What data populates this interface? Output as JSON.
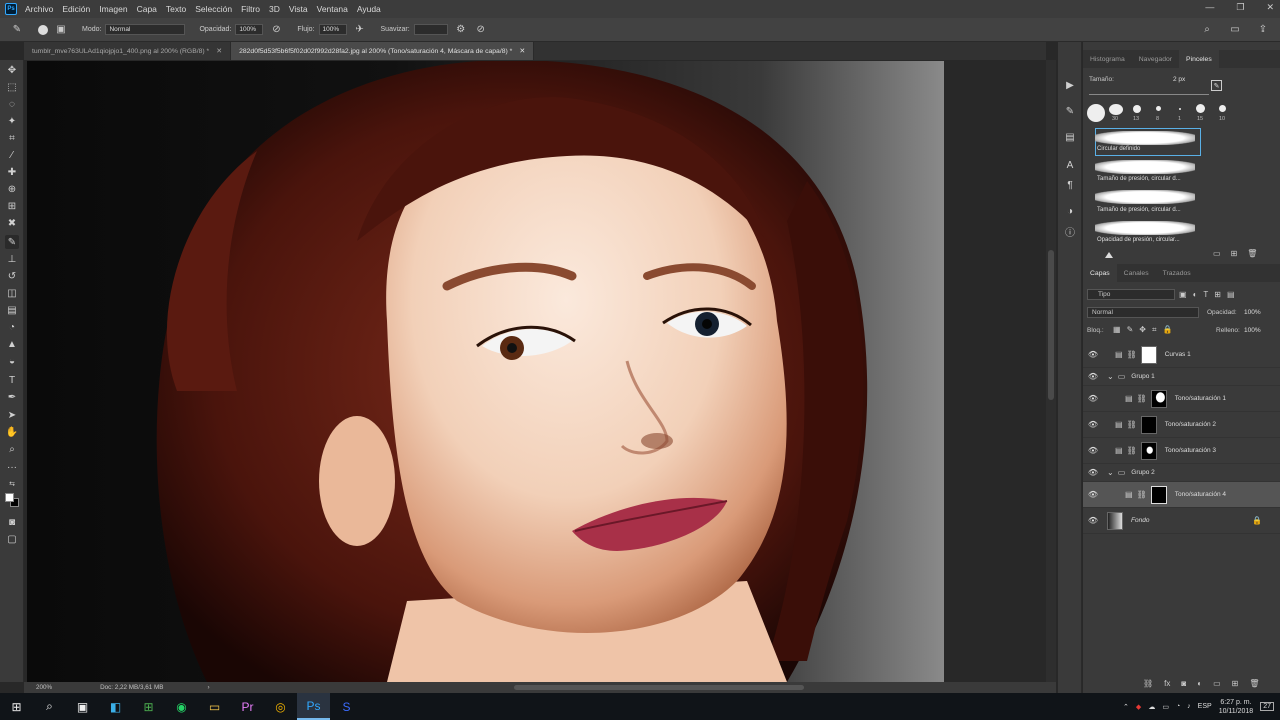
{
  "menubar": {
    "logo": "Ps",
    "items": [
      "Archivo",
      "Edición",
      "Imagen",
      "Capa",
      "Texto",
      "Selección",
      "Filtro",
      "3D",
      "Vista",
      "Ventana",
      "Ayuda"
    ],
    "window_controls": [
      "—",
      "❐",
      "✕"
    ]
  },
  "options": {
    "mode_label": "Modo:",
    "mode_value": "Normal",
    "opacity_label": "Opacidad:",
    "opacity_value": "100%",
    "flow_label": "Flujo:",
    "flow_value": "100%",
    "smooth_label": "Suavizar:",
    "smooth_value": ""
  },
  "tabs": [
    {
      "label": "tumblr_mve763ULAd1qiojpjo1_400.png al 200% (RGB/8) *"
    },
    {
      "label": "282d0f5d53f5b6f5f02d02f992d28fa2.jpg al 200% (Tono/saturación 4, Máscara de capa/8) *"
    }
  ],
  "status": {
    "zoom": "200%",
    "doc": "Doc: 2,22 MB/3,61 MB"
  },
  "brush_panel": {
    "tabs": [
      "Histograma",
      "Navegador",
      "Pinceles"
    ],
    "size_label": "Tamaño:",
    "size_value": "2 px",
    "presets": [
      "30",
      "13",
      "8",
      "1",
      "15",
      "10"
    ],
    "brushes": [
      "Circular definido",
      "Tamaño de presión, circular d...",
      "Tamaño de presión, circular d...",
      "Opacidad de presión, circular..."
    ]
  },
  "layers_panel": {
    "tabs": [
      "Capas",
      "Canales",
      "Trazados"
    ],
    "filter": "Tipo",
    "blend_mode": "Normal",
    "opacity_label": "Opacidad:",
    "opacity_value": "100%",
    "lock_label": "Bloq.:",
    "fill_label": "Relleno:",
    "fill_value": "100%",
    "layers": [
      {
        "name": "Curvas 1"
      },
      {
        "name": "Grupo 1"
      },
      {
        "name": "Tono/saturación 1"
      },
      {
        "name": "Tono/saturación 2"
      },
      {
        "name": "Tono/saturación 3"
      },
      {
        "name": "Grupo 2"
      },
      {
        "name": "Tono/saturación 4"
      },
      {
        "name": "Fondo"
      }
    ]
  },
  "taskbar": {
    "lang": "ESP",
    "time": "6:27 p. m.",
    "date": "10/11/2018",
    "notifications": "27"
  }
}
